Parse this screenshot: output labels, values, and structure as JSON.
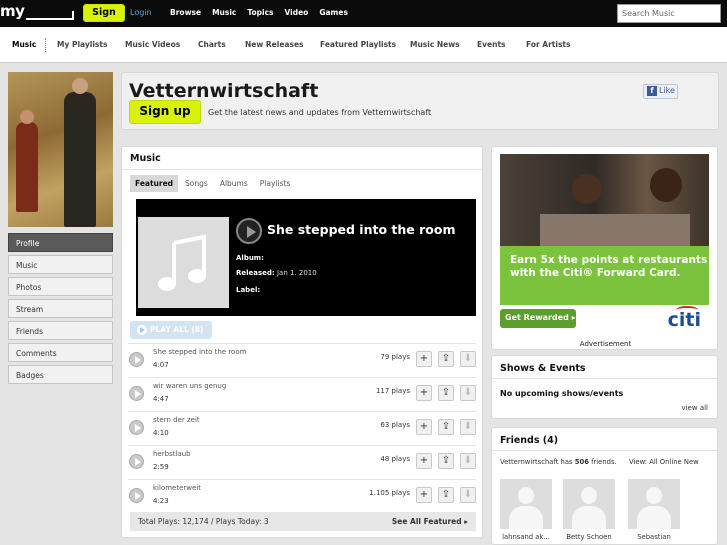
{
  "topbar": {
    "logo": "my",
    "signup": "Sign up",
    "login": "Login",
    "nav": [
      "Browse",
      "Music",
      "Topics",
      "Video",
      "Games"
    ],
    "search_placeholder": "Search Music"
  },
  "subnav": {
    "items": [
      "Music",
      "My Playlists",
      "Music Videos",
      "Charts",
      "New Releases",
      "Featured Playlists",
      "Music News",
      "Events",
      "For Artists"
    ]
  },
  "sidebar": {
    "items": [
      "Profile",
      "Music",
      "Photos",
      "Stream",
      "Friends",
      "Comments",
      "Badges"
    ],
    "active": "Profile"
  },
  "header": {
    "artist": "Vetternwirtschaft",
    "signup": "Sign up",
    "subtitle": "Get the latest news and updates from Vetternwirtschaft",
    "like": "Like"
  },
  "music": {
    "title": "Music",
    "tabs": [
      "Featured",
      "Songs",
      "Albums",
      "Playlists"
    ],
    "featured": {
      "label": "",
      "song": "She stepped into the room",
      "album_label": "Album:",
      "album": "",
      "released_label": "Released:",
      "released": "Jan 1. 2010",
      "label_label": "Label:"
    },
    "play_all": "PLAY ALL (8)",
    "tracks": [
      {
        "name": "She stepped into the room",
        "duration": "4:07",
        "plays": "79 plays"
      },
      {
        "name": "wir waren uns genug",
        "duration": "4:47",
        "plays": "117 plays"
      },
      {
        "name": "stern der zeit",
        "duration": "4:10",
        "plays": "63 plays"
      },
      {
        "name": "herbstlaub",
        "duration": "2:59",
        "plays": "48 plays"
      },
      {
        "name": "kilometerweit",
        "duration": "4:23",
        "plays": "1.105 plays"
      }
    ],
    "totals": "Total Plays: 12,174 / Plays Today: 3",
    "see_all": "See All Featured ▸"
  },
  "ad": {
    "headline": "Earn 5x the points at restaurants with the Citi® Forward Card.",
    "cta": "Get Rewarded ▸",
    "brand": "citi",
    "caption": "Advertisement"
  },
  "shows": {
    "title": "Shows & Events",
    "empty": "No upcoming shows/events",
    "view_all": "view all"
  },
  "friends": {
    "title": "Friends (4)",
    "summary_prefix": "Vetternwirtschaft has ",
    "count": "506",
    "summary_suffix": " friends.",
    "view": "View:  All  Online  New",
    "list": [
      "lahnsand ak...",
      "Betty Schoen",
      "Sebastian"
    ]
  },
  "colors": {
    "accent_green": "#d9f20a",
    "topbar": "#0b0b0b",
    "ad_green": "#7bc33c",
    "citi_blue": "#1c4b9c"
  }
}
